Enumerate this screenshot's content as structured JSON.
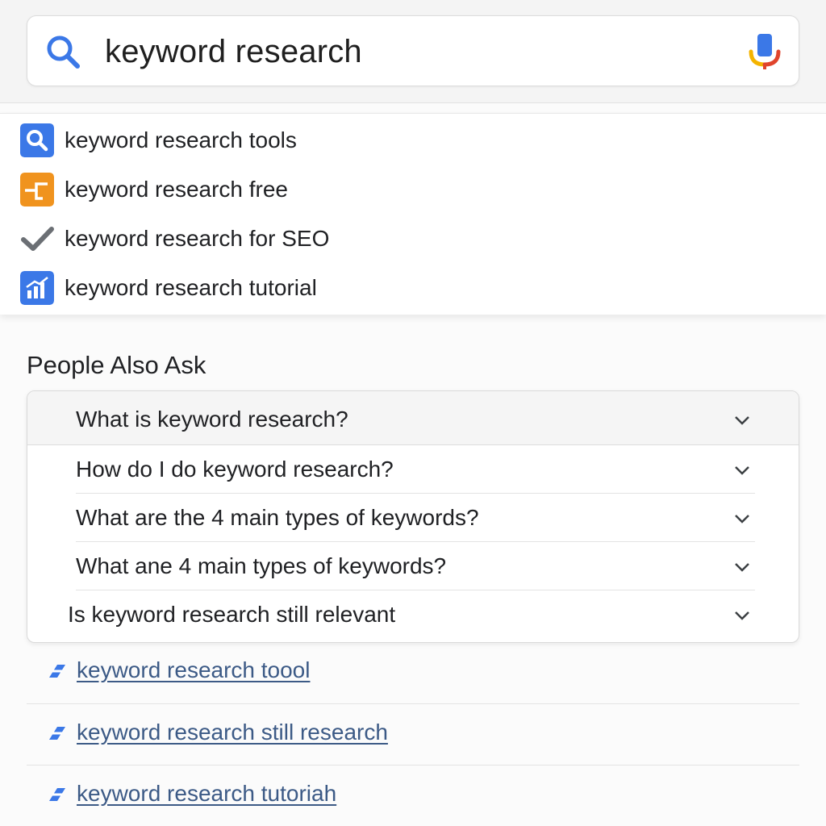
{
  "search": {
    "query": "keyword research",
    "search_icon": "search-icon",
    "mic_icon": "microphone-icon"
  },
  "suggestions": [
    {
      "label": "keyword research tools",
      "icon": "search-icon",
      "color": "#3b78e7"
    },
    {
      "label": "keyword research free",
      "icon": "flowchart-icon",
      "color": "#f0931e"
    },
    {
      "label": "keyword research for SEO",
      "icon": "checkmark-icon",
      "color": "#6b6f74"
    },
    {
      "label": "keyword research tutorial",
      "icon": "bar-chart-icon",
      "color": "#3b78e7"
    }
  ],
  "people_also_ask": {
    "title": "People Also Ask",
    "questions": [
      "What is keyword research?",
      "How do I do keyword research?",
      "What are the 4 main types of keywords?",
      "What ane 4 main types of keywords?",
      "Is keyword research still relevant"
    ]
  },
  "related_searches": [
    {
      "label": "keyword research toool",
      "icon": "link-icon"
    },
    {
      "label": "keyword research still research",
      "icon": "link-icon"
    },
    {
      "label": "keyword research tutoriah",
      "icon": "link-icon"
    }
  ],
  "colors": {
    "accent_blue": "#3b78e7",
    "accent_orange": "#f0931e",
    "mic_red": "#e0442c",
    "mic_yellow": "#f4b400",
    "link_color": "#3c5a86"
  }
}
